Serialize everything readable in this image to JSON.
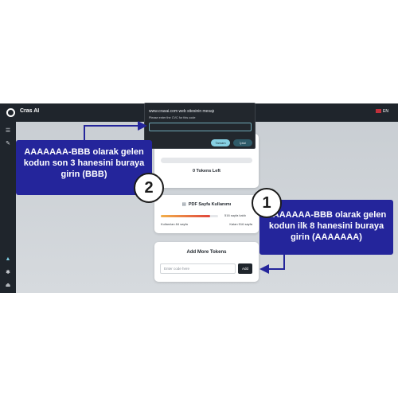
{
  "app": {
    "title": "Cras AI",
    "language": "EN"
  },
  "sidebar": {
    "icons": [
      "menu-icon",
      "edit-icon",
      "warning-icon",
      "settings-icon",
      "logout-icon"
    ]
  },
  "tokens_card": {
    "tokens_left": "0 Tokens Left"
  },
  "pdf_card": {
    "title": "PDF Sayfa Kullanımı",
    "remaining": "516 sayfa kaldı",
    "used": "Kullanılan 84 sayfa",
    "remaining_bottom": "Kalan 516 sayfa",
    "usage_fraction": 0.86
  },
  "add_tokens_card": {
    "title": "Add More Tokens",
    "placeholder": "Enter code here",
    "add_label": "Add"
  },
  "dialog": {
    "title": "www.crasai.com web sitesinin mesajı",
    "message": "Please enter the CVC for this code",
    "ok_label": "Tamam",
    "cancel_label": "İptal"
  },
  "callouts": {
    "step2": {
      "number": "2",
      "text": "AAAAAAA-BBB olarak gelen kodun son 3 hanesini buraya girin (BBB)"
    },
    "step1": {
      "number": "1",
      "text": "AAAAAAA-BBB olarak gelen kodun ilk 8 hanesini buraya girin (AAAAAAA)"
    }
  },
  "colors": {
    "sidebar": "#1f252c",
    "callout": "#24259b",
    "accent": "#86d0e3"
  }
}
